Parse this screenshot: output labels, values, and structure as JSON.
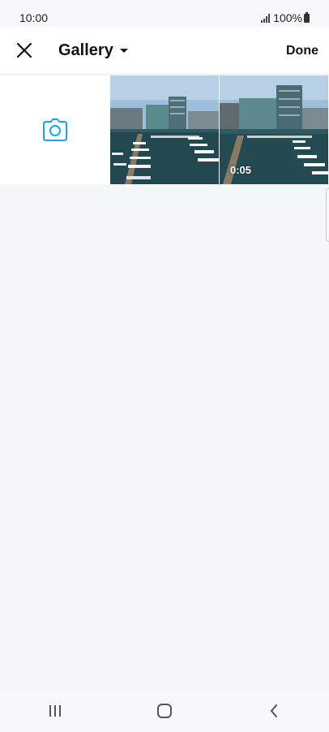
{
  "status_bar": {
    "time": "10:00",
    "battery": "100%"
  },
  "header": {
    "title": "Gallery",
    "done_label": "Done"
  },
  "media": {
    "items": [
      {
        "type": "photo"
      },
      {
        "type": "video",
        "duration": "0:05"
      }
    ]
  },
  "colors": {
    "accent": "#1d9bf0",
    "camera_icon": "#1da1f2"
  },
  "icons": [
    "close-icon",
    "caret-down-icon",
    "camera-icon",
    "recent-apps-icon",
    "home-icon",
    "back-icon"
  ]
}
